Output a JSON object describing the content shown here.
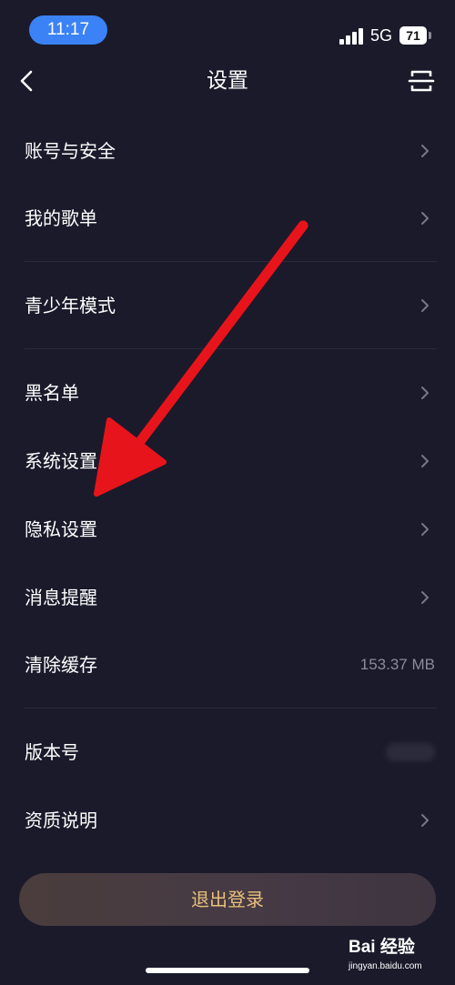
{
  "status_bar": {
    "time": "11:17",
    "network": "5G",
    "battery": "71"
  },
  "nav": {
    "title": "设置"
  },
  "settings": {
    "account_security": "账号与安全",
    "my_playlists": "我的歌单",
    "teen_mode": "青少年模式",
    "blacklist": "黑名单",
    "system_settings": "系统设置",
    "privacy_settings": "隐私设置",
    "message_reminder": "消息提醒",
    "clear_cache": "清除缓存",
    "cache_size": "153.37 MB",
    "version": "版本号",
    "qualification": "资质说明"
  },
  "logout_label": "退出登录",
  "watermark": {
    "brand": "Bai 经验",
    "url": "jingyan.baidu.com"
  },
  "colors": {
    "background": "#1b1a2b",
    "accent_text": "#e9c07a",
    "annotation_arrow": "#e8141b"
  }
}
